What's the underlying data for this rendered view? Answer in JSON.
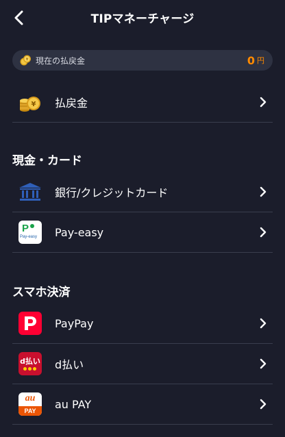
{
  "header": {
    "title": "TIPマネーチャージ"
  },
  "balance": {
    "label": "現在の払戻金",
    "value": "0",
    "unit": "円"
  },
  "refund_row": {
    "label": "払戻金"
  },
  "sections": {
    "cash_card": {
      "heading": "現金・カード",
      "items": [
        {
          "label": "銀行/クレジットカード"
        },
        {
          "label": "Pay-easy",
          "icon_text": "Pay-easy"
        }
      ]
    },
    "smartphone": {
      "heading": "スマホ決済",
      "items": [
        {
          "label": "PayPay"
        },
        {
          "label": "d払い",
          "icon_text": "d払い"
        },
        {
          "label": "au PAY",
          "icon_text_top": "au",
          "icon_text_bottom": "PAY"
        }
      ]
    }
  },
  "colors": {
    "background": "#1b1d2b",
    "accent_orange": "#ff8a00",
    "paypay_red": "#ff0033",
    "dpay_red": "#c8102e",
    "aupay_orange": "#eb5505"
  }
}
